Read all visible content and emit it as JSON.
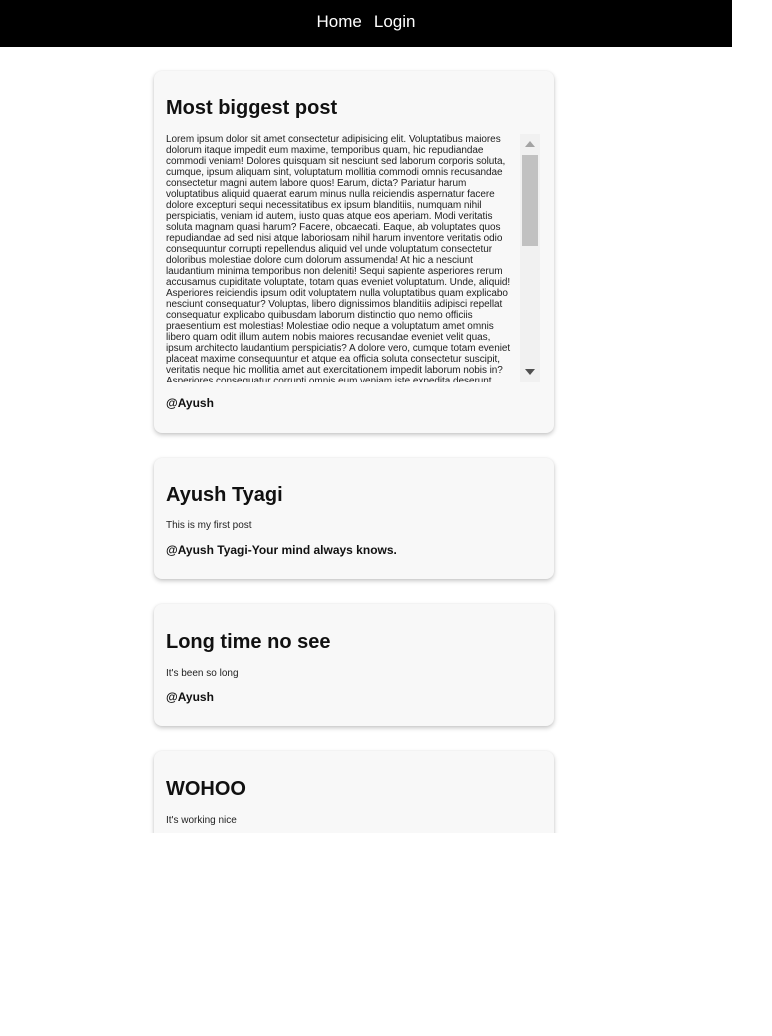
{
  "nav": {
    "home_label": "Home",
    "login_label": "Login"
  },
  "posts": [
    {
      "title": "Most biggest post",
      "body": "Lorem ipsum dolor sit amet consectetur adipisicing elit. Voluptatibus maiores dolorum itaque impedit eum maxime, temporibus quam, hic repudiandae commodi veniam! Dolores quisquam sit nesciunt sed laborum corporis soluta, cumque, ipsum aliquam sint, voluptatum mollitia commodi omnis recusandae consectetur magni autem labore quos! Earum, dicta? Pariatur harum voluptatibus aliquid quaerat earum minus nulla reiciendis aspernatur facere dolore excepturi sequi necessitatibus ex ipsum blanditiis, numquam nihil perspiciatis, veniam id autem, iusto quas atque eos aperiam. Modi veritatis soluta magnam quasi harum? Facere, obcaecati. Eaque, ab voluptates quos repudiandae ad sed nisi atque laboriosam nihil harum inventore veritatis odio consequuntur corrupti repellendus aliquid vel unde voluptatum consectetur doloribus molestiae dolore cum dolorum assumenda! At hic a nesciunt laudantium minima temporibus non deleniti! Sequi sapiente asperiores rerum accusamus cupiditate voluptate, totam quas eveniet voluptatum. Unde, aliquid! Asperiores reiciendis ipsum odit voluptatem nulla voluptatibus quam explicabo nesciunt consequatur? Voluptas, libero dignissimos blanditiis adipisci repellat consequatur explicabo quibusdam laborum distinctio quo nemo officiis praesentium est molestias! Molestiae odio neque a voluptatum amet omnis libero quam odit illum autem nobis maiores recusandae eveniet velit quas, ipsum architecto laudantium perspiciatis? A dolore vero, cumque totam eveniet placeat maxime consequuntur et atque ea officia soluta consectetur suscipit, veritatis neque hic mollitia amet aut exercitationem impedit laborum nobis in? Asperiores consequatur corrupti omnis eum veniam iste expedita deserunt",
      "author": "@Ayush"
    },
    {
      "title": "Ayush Tyagi",
      "body": "This is my first post",
      "author": "@Ayush Tyagi-Your mind always knows."
    },
    {
      "title": "Long time no see",
      "body": "It's been so long",
      "author": "@Ayush"
    },
    {
      "title": "WOHOO",
      "body": "It's working nice",
      "author": ""
    }
  ]
}
